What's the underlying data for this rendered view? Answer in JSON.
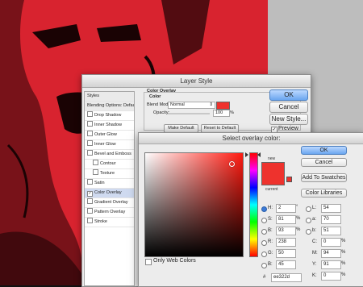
{
  "layer_style": {
    "title": "Layer Style",
    "styles_list": [
      {
        "label": "Styles",
        "type": "hdr"
      },
      {
        "label": "Blending Options: Default",
        "type": "hdr"
      },
      {
        "label": "Drop Shadow",
        "type": "check"
      },
      {
        "label": "Inner Shadow",
        "type": "check"
      },
      {
        "label": "Outer Glow",
        "type": "check"
      },
      {
        "label": "Inner Glow",
        "type": "check"
      },
      {
        "label": "Bevel and Emboss",
        "type": "check"
      },
      {
        "label": "Contour",
        "type": "sub"
      },
      {
        "label": "Texture",
        "type": "sub"
      },
      {
        "label": "Satin",
        "type": "check"
      },
      {
        "label": "Color Overlay",
        "type": "selected"
      },
      {
        "label": "Gradient Overlay",
        "type": "check"
      },
      {
        "label": "Pattern Overlay",
        "type": "check"
      },
      {
        "label": "Stroke",
        "type": "check"
      }
    ],
    "section_title": "Color Overlay",
    "group_title": "Color",
    "blend_mode_label": "Blend Mode:",
    "blend_mode_value": "Normal",
    "opacity_label": "Opacity:",
    "opacity_value": "100",
    "opacity_unit": "%",
    "make_default": "Make Default",
    "reset_default": "Reset to Default",
    "ok": "OK",
    "cancel": "Cancel",
    "new_style": "New Style...",
    "preview": "Preview",
    "overlay_color": "#ee322d"
  },
  "color_picker": {
    "title": "Select overlay color:",
    "new_label": "new",
    "current_label": "current",
    "ok": "OK",
    "cancel": "Cancel",
    "add_to_swatches": "Add To Swatches",
    "color_libraries": "Color Libraries",
    "only_web_colors": "Only Web Colors",
    "hsb": {
      "h": "2",
      "h_unit": "°",
      "s": "81",
      "s_unit": "%",
      "b": "93",
      "b_unit": "%"
    },
    "rgb": {
      "r": "238",
      "g": "50",
      "b": "45"
    },
    "lab": {
      "l": "54",
      "a": "70",
      "b": "51"
    },
    "cmyk": {
      "c": "0",
      "m": "94",
      "y": "91",
      "k": "0",
      "unit": "%"
    },
    "hex_label": "#",
    "hex": "ee322d",
    "labels": {
      "h": "H:",
      "s": "S:",
      "b": "B:",
      "r": "R:",
      "g": "G:",
      "b2": "B:",
      "l": "L:",
      "a": "a:",
      "b3": "b:",
      "c": "C:",
      "m": "M:",
      "y": "Y:",
      "k": "K:"
    }
  }
}
